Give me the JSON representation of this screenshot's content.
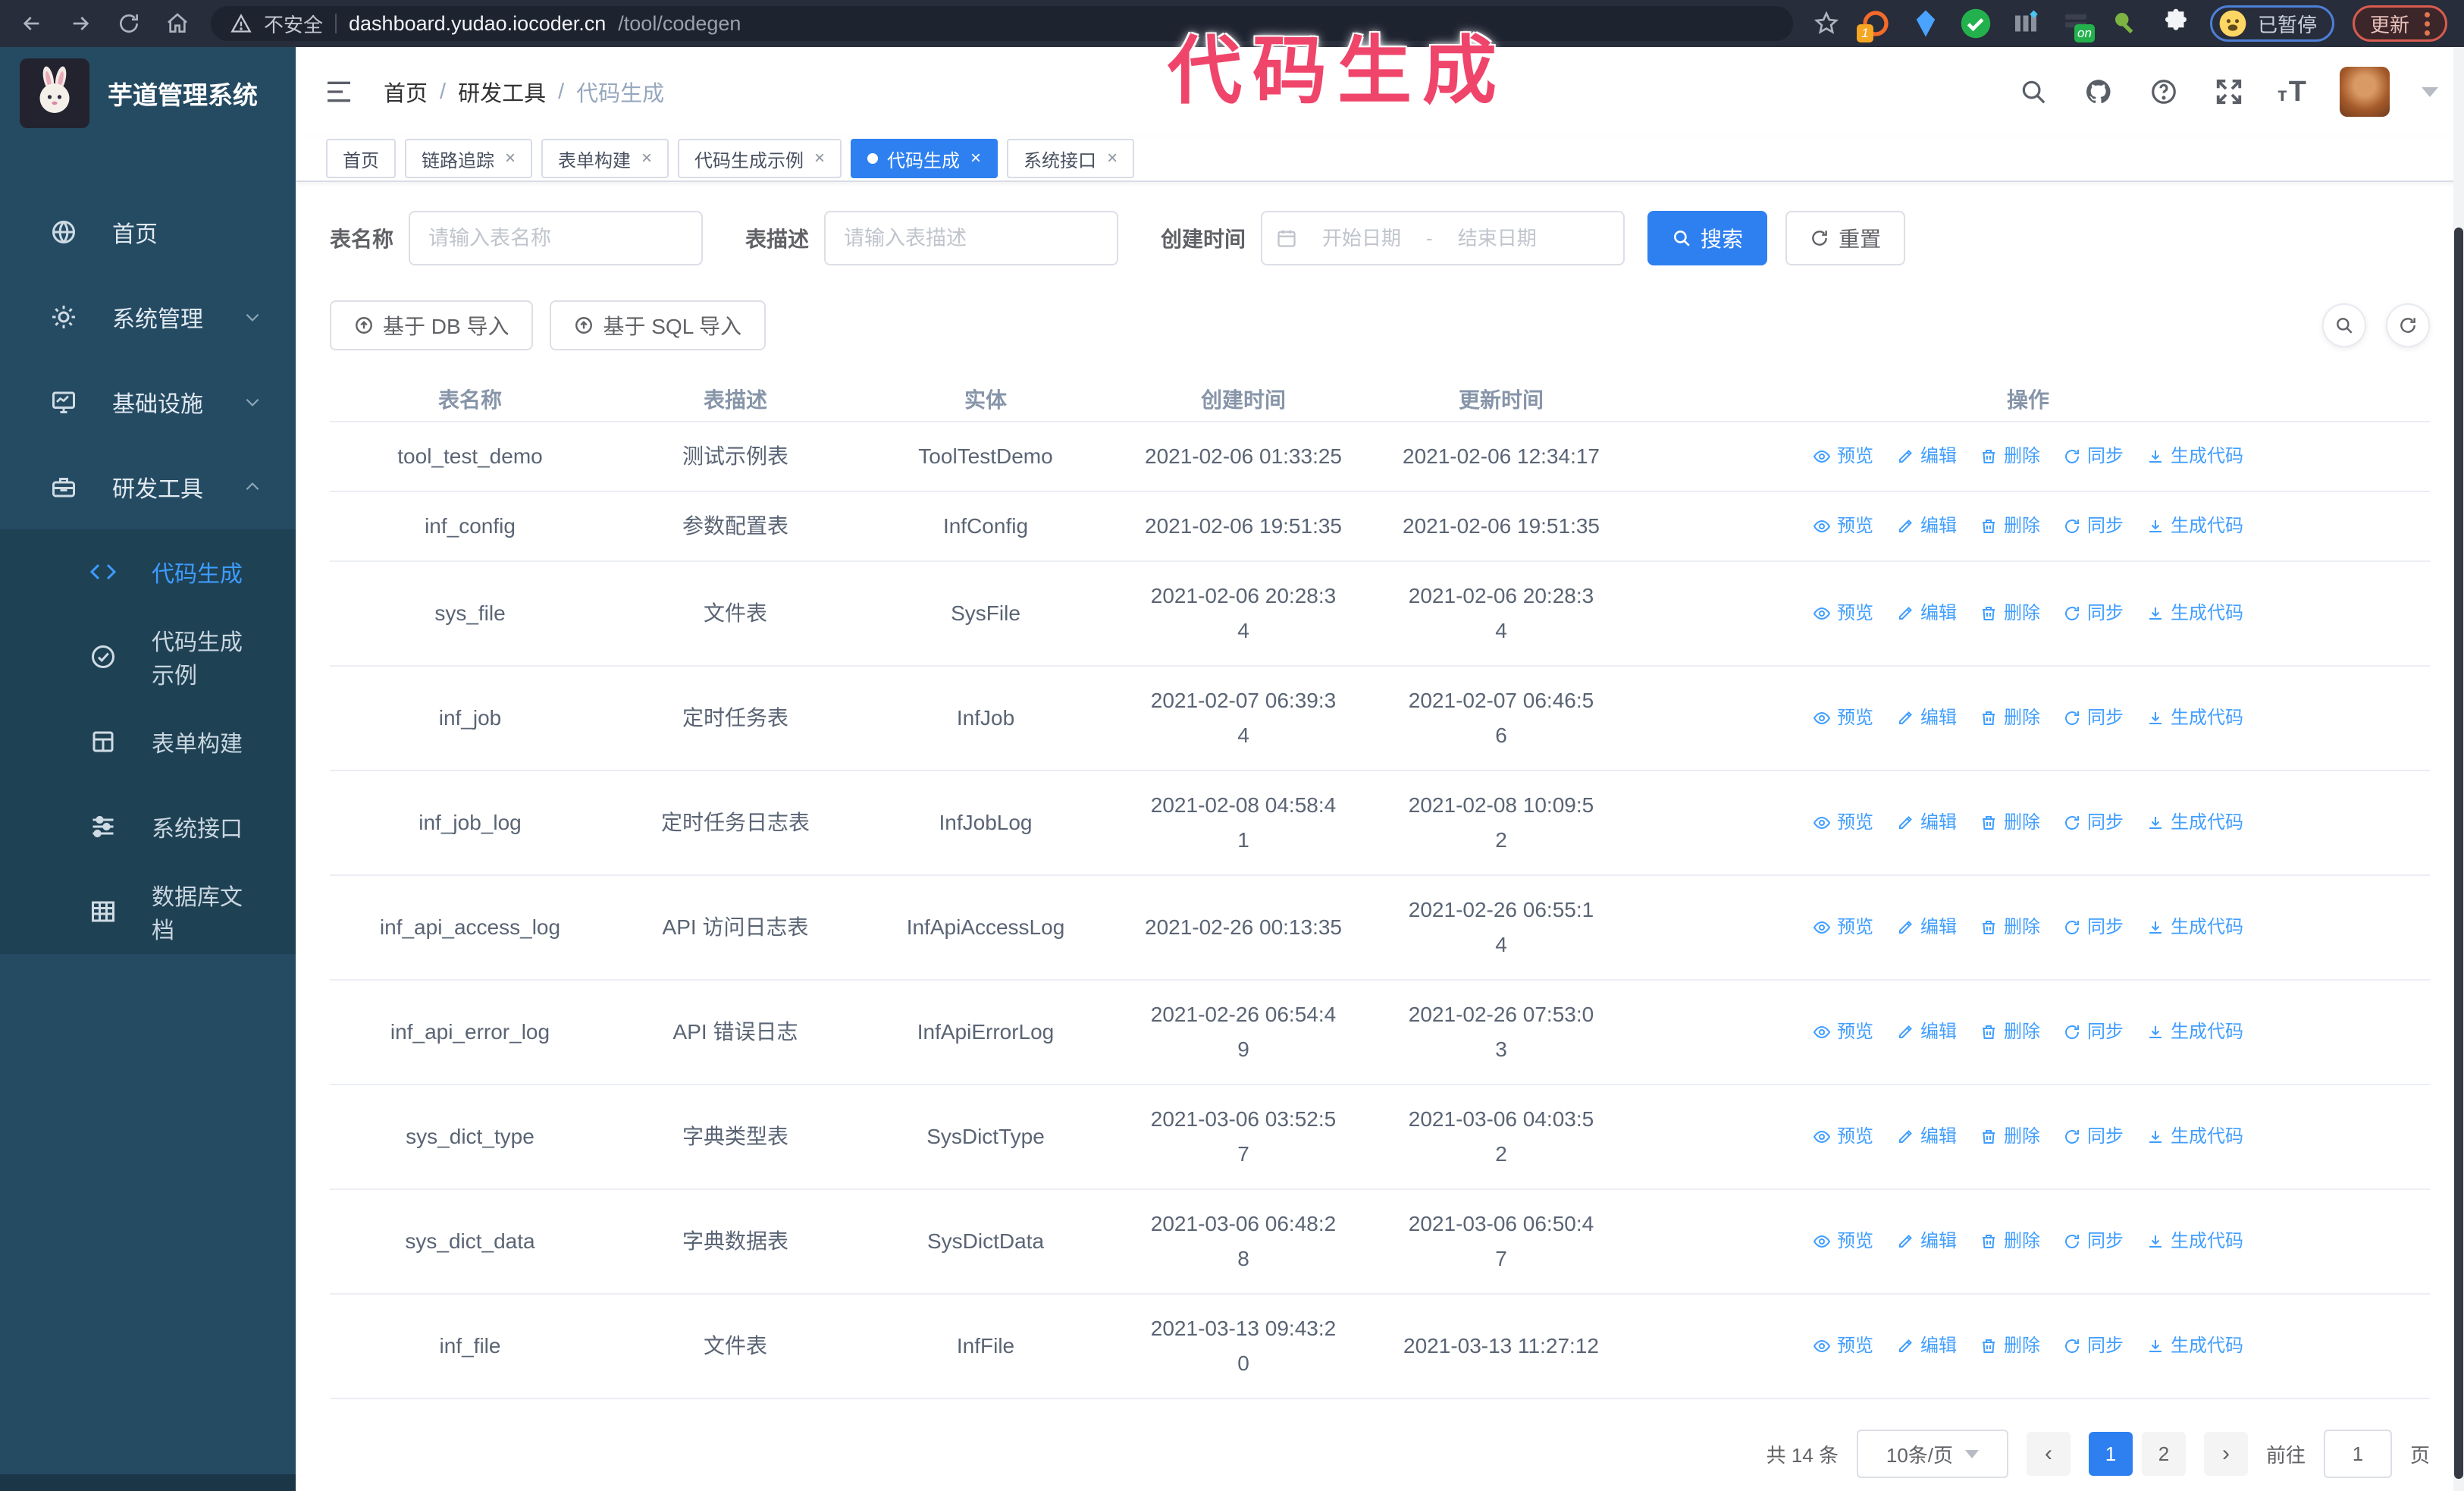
{
  "colors": {
    "primary_blue": "#2e80f0",
    "link_blue": "#409eff",
    "sidebar_bg": "#254b63",
    "submenu_bg": "#1f4154",
    "annotation_pink": "#f0456b",
    "chrome_bg": "#272d3a"
  },
  "annotation": {
    "text": "代码生成",
    "color": "#f0456b"
  },
  "browser": {
    "security_label": "不安全",
    "url_host": "dashboard.yudao.iocoder.cn",
    "url_path": "/tool/codegen",
    "extension_badge": "1",
    "extension_on_badge": "on",
    "profile_chip_label": "已暂停",
    "update_button_label": "更新"
  },
  "sidebar": {
    "logo_title": "芋道管理系统",
    "items": [
      {
        "key": "home",
        "label": "首页",
        "icon": "dashboard-icon"
      },
      {
        "key": "system-management",
        "label": "系统管理",
        "icon": "gear-icon",
        "chevron": "down"
      },
      {
        "key": "infrastructure",
        "label": "基础设施",
        "icon": "monitor-icon",
        "chevron": "down"
      },
      {
        "key": "dev-tools",
        "label": "研发工具",
        "icon": "toolbox-icon",
        "chevron": "up",
        "active": true
      }
    ],
    "subitems": [
      {
        "key": "codegen",
        "label": "代码生成",
        "icon": "code-icon",
        "active": true
      },
      {
        "key": "codegen-example",
        "label": "代码生成示例",
        "icon": "badge-check-icon"
      },
      {
        "key": "form-builder",
        "label": "表单构建",
        "icon": "form-icon"
      },
      {
        "key": "system-api",
        "label": "系统接口",
        "icon": "sliders-icon"
      },
      {
        "key": "db-doc",
        "label": "数据库文档",
        "icon": "database-icon"
      }
    ]
  },
  "header": {
    "breadcrumb": [
      "首页",
      "研发工具",
      "代码生成"
    ]
  },
  "tabs": [
    {
      "key": "home",
      "label": "首页",
      "closable": false
    },
    {
      "key": "tracing",
      "label": "链路追踪",
      "closable": true
    },
    {
      "key": "form-builder",
      "label": "表单构建",
      "closable": true
    },
    {
      "key": "codegen-example",
      "label": "代码生成示例",
      "closable": true
    },
    {
      "key": "codegen",
      "label": "代码生成",
      "closable": true,
      "active": true
    },
    {
      "key": "system-api",
      "label": "系统接口",
      "closable": true
    }
  ],
  "filters": {
    "name_label": "表名称",
    "name_placeholder": "请输入表名称",
    "desc_label": "表描述",
    "desc_placeholder": "请输入表描述",
    "time_label": "创建时间",
    "start_placeholder": "开始日期",
    "range_separator": "-",
    "end_placeholder": "结束日期",
    "search_label": "搜索",
    "reset_label": "重置"
  },
  "toolbar": {
    "import_db_label": "基于 DB 导入",
    "import_sql_label": "基于 SQL 导入"
  },
  "table": {
    "columns": [
      "表名称",
      "表描述",
      "实体",
      "创建时间",
      "更新时间",
      "操作"
    ],
    "actions": [
      {
        "label": "预览",
        "icon": "eye-icon"
      },
      {
        "label": "编辑",
        "icon": "edit-icon"
      },
      {
        "label": "删除",
        "icon": "trash-icon"
      },
      {
        "label": "同步",
        "icon": "sync-icon"
      },
      {
        "label": "生成代码",
        "icon": "download-icon"
      }
    ],
    "rows": [
      {
        "name": "tool_test_demo",
        "description": "测试示例表",
        "entity": "ToolTestDemo",
        "create_time": "2021-02-06 01:33:25",
        "update_time": "2021-02-06 12:34:17"
      },
      {
        "name": "inf_config",
        "description": "参数配置表",
        "entity": "InfConfig",
        "create_time": "2021-02-06 19:51:35",
        "update_time": "2021-02-06 19:51:35"
      },
      {
        "name": "sys_file",
        "description": "文件表",
        "entity": "SysFile",
        "create_time": "2021-02-06 20:28:3\n4",
        "update_time": "2021-02-06 20:28:3\n4"
      },
      {
        "name": "inf_job",
        "description": "定时任务表",
        "entity": "InfJob",
        "create_time": "2021-02-07 06:39:3\n4",
        "update_time": "2021-02-07 06:46:5\n6"
      },
      {
        "name": "inf_job_log",
        "description": "定时任务日志表",
        "entity": "InfJobLog",
        "create_time": "2021-02-08 04:58:4\n1",
        "update_time": "2021-02-08 10:09:5\n2"
      },
      {
        "name": "inf_api_access_log",
        "description": "API 访问日志表",
        "entity": "InfApiAccessLog",
        "create_time": "2021-02-26 00:13:35",
        "update_time": "2021-02-26 06:55:1\n4"
      },
      {
        "name": "inf_api_error_log",
        "description": "API 错误日志",
        "entity": "InfApiErrorLog",
        "create_time": "2021-02-26 06:54:4\n9",
        "update_time": "2021-02-26 07:53:0\n3"
      },
      {
        "name": "sys_dict_type",
        "description": "字典类型表",
        "entity": "SysDictType",
        "create_time": "2021-03-06 03:52:5\n7",
        "update_time": "2021-03-06 04:03:5\n2"
      },
      {
        "name": "sys_dict_data",
        "description": "字典数据表",
        "entity": "SysDictData",
        "create_time": "2021-03-06 06:48:2\n8",
        "update_time": "2021-03-06 06:50:4\n7"
      },
      {
        "name": "inf_file",
        "description": "文件表",
        "entity": "InfFile",
        "create_time": "2021-03-13 09:43:2\n0",
        "update_time": "2021-03-13 11:27:12"
      }
    ]
  },
  "pagination": {
    "total_text": "共 14 条",
    "page_size": "10条/页",
    "prev": "‹",
    "next": "›",
    "pages": [
      "1",
      "2"
    ],
    "active_page": "1",
    "goto_label": "前往",
    "goto_value": "1",
    "goto_suffix": "页"
  }
}
